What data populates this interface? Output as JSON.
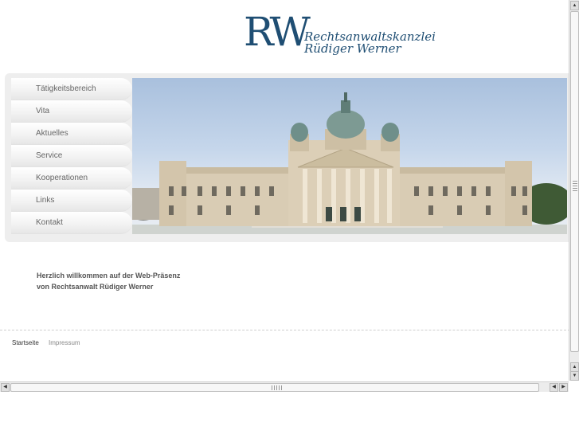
{
  "logo": {
    "mark": "RW",
    "line1": "Rechtsanwaltskanzlei",
    "line2": "Rüdiger Werner"
  },
  "nav": {
    "items": [
      {
        "label": "Tätigkeitsbereich"
      },
      {
        "label": "Vita"
      },
      {
        "label": "Aktuelles"
      },
      {
        "label": "Service"
      },
      {
        "label": "Kooperationen"
      },
      {
        "label": "Links"
      },
      {
        "label": "Kontakt"
      }
    ]
  },
  "welcome": {
    "line1": "Herzlich willkommen auf der Web-Präsenz",
    "line2": "von Rechtsanwalt Rüdiger Werner"
  },
  "footer": {
    "home": "Startseite",
    "imprint": "Impressum"
  },
  "scroll": {
    "up": "▲",
    "down": "▼",
    "left": "◀",
    "right": "▶"
  },
  "colors": {
    "brand": "#1f4e73",
    "sky": "#b9cde6",
    "building": "#d8cbb3",
    "roof": "#6f8f8a"
  }
}
